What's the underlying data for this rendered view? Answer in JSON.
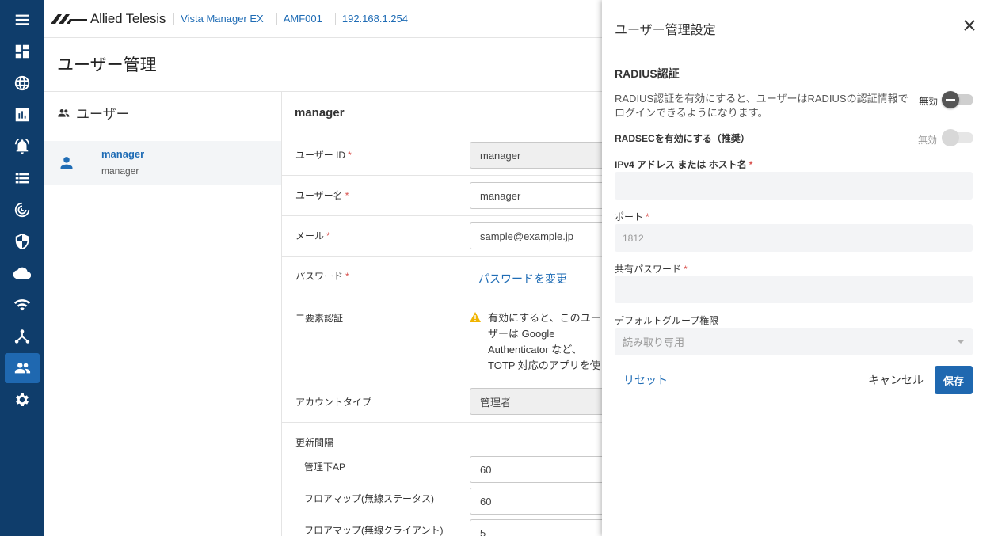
{
  "header": {
    "brand": "Allied Telesis",
    "product": "Vista Manager EX",
    "device": "AMF001",
    "ip": "192.168.1.254"
  },
  "page": {
    "title": "ユーザー管理"
  },
  "users": {
    "heading": "ユーザー",
    "items": [
      {
        "name": "manager",
        "sub": "manager"
      }
    ]
  },
  "detail": {
    "title": "manager",
    "user_id": {
      "label": "ユーザー ID",
      "value": "manager"
    },
    "username": {
      "label": "ユーザー名",
      "value": "manager"
    },
    "email": {
      "label": "メール",
      "value": "sample@example.jp"
    },
    "password": {
      "label": "パスワード",
      "link": "パスワードを変更"
    },
    "two_factor": {
      "label": "二要素認証",
      "warning": "有効にすると、このユーザーは Google Authenticator など、TOTP 対応のアプリを使用する必要があります。ログイン時に認証が設定を求められます。"
    },
    "account_type": {
      "label": "アカウントタイプ",
      "value": "管理者"
    },
    "refresh": {
      "label": "更新間隔",
      "rows": [
        {
          "label": "管理下AP",
          "value": "60"
        },
        {
          "label": "フロアマップ(無線ステータス)",
          "value": "60"
        },
        {
          "label": "フロアマップ(無線クライアント)",
          "value": "5"
        }
      ]
    }
  },
  "drawer": {
    "title": "ユーザー管理設定",
    "section": "RADIUS認証",
    "description": "RADIUS認証を有効にすると、ユーザーはRADIUSの認証情報でログインできるようになります。",
    "radius_toggle": {
      "label": "無効",
      "on": false
    },
    "radsec": {
      "label": "RADSECを有効にする（推奨）",
      "state": "無効",
      "on": false
    },
    "host": {
      "label": "IPv4 アドレス または ホスト名",
      "value": ""
    },
    "port": {
      "label": "ポート",
      "value": "1812"
    },
    "secret": {
      "label": "共有パスワード",
      "value": ""
    },
    "group": {
      "label": "デフォルトグループ権限",
      "value": "読み取り専用"
    },
    "reset": "リセット",
    "cancel": "キャンセル",
    "save": "保存"
  },
  "nav_icons": [
    "menu-icon",
    "dashboard-icon",
    "globe-icon",
    "chart-icon",
    "alarm-icon",
    "list-icon",
    "radar-icon",
    "shield-icon",
    "cloud-icon",
    "wifi-icon",
    "topology-icon",
    "users-icon",
    "gear-icon"
  ],
  "colors": {
    "nav": "#0f3d6b",
    "accent": "#1f68b0",
    "link": "#1f6cb5",
    "required": "#d9534f"
  }
}
